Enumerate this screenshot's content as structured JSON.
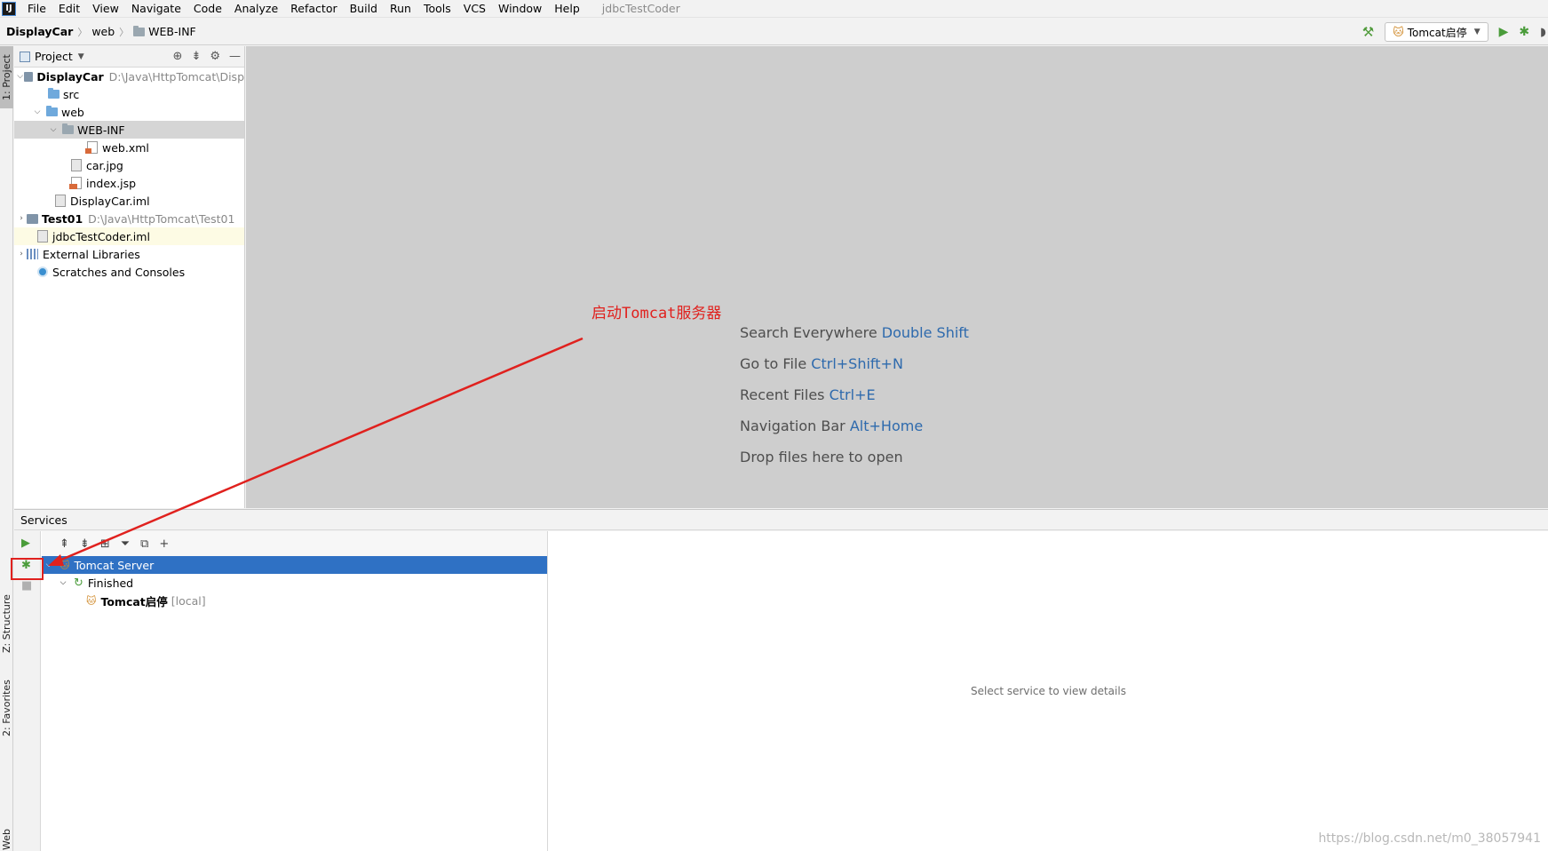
{
  "menubar": {
    "logo": "IJ",
    "items": [
      "File",
      "Edit",
      "View",
      "Navigate",
      "Code",
      "Analyze",
      "Refactor",
      "Build",
      "Run",
      "Tools",
      "VCS",
      "Window",
      "Help"
    ],
    "project_title": "jdbcTestCoder"
  },
  "navbar": {
    "crumbs": [
      "DisplayCar",
      "web",
      "WEB-INF"
    ],
    "run_config": "Tomcat启停",
    "icons": [
      "hammer-icon",
      "play-icon",
      "bug-icon",
      "shield-icon"
    ]
  },
  "left_stripe": {
    "project_tab": "1: Project",
    "structure_tab": "Z: Structure",
    "favorites_tab": "2: Favorites",
    "web_tab": "Web"
  },
  "project_panel": {
    "title": "Project",
    "tree": [
      {
        "label": "DisplayCar",
        "path": "D:\\Java\\HttpTomcat\\Disp",
        "bold": true
      },
      {
        "label": "src"
      },
      {
        "label": "web"
      },
      {
        "label": "WEB-INF"
      },
      {
        "label": "web.xml"
      },
      {
        "label": "car.jpg"
      },
      {
        "label": "index.jsp"
      },
      {
        "label": "DisplayCar.iml"
      },
      {
        "label": "Test01",
        "path": "D:\\Java\\HttpTomcat\\Test01",
        "bold": true
      },
      {
        "label": "jdbcTestCoder.iml"
      },
      {
        "label": "External Libraries"
      },
      {
        "label": "Scratches and Consoles"
      }
    ]
  },
  "editor": {
    "hints": [
      {
        "text": "Search Everywhere",
        "key": "Double Shift"
      },
      {
        "text": "Go to File",
        "key": "Ctrl+Shift+N"
      },
      {
        "text": "Recent Files",
        "key": "Ctrl+E"
      },
      {
        "text": "Navigation Bar",
        "key": "Alt+Home"
      },
      {
        "text": "Drop files here to open",
        "key": ""
      }
    ]
  },
  "services": {
    "title": "Services",
    "tree": [
      {
        "label": "Tomcat Server"
      },
      {
        "label": "Finished"
      },
      {
        "label": "Tomcat启停",
        "suffix": "[local]"
      }
    ],
    "details_placeholder": "Select service to view details"
  },
  "annotation": {
    "text": "启动Tomcat服务器"
  },
  "watermark": "https://blog.csdn.net/m0_38057941",
  "colors": {
    "selection": "#2f71c4",
    "annotation": "#e0211e",
    "shortcut": "#2e6aad",
    "run_green": "#4a9c3a"
  }
}
